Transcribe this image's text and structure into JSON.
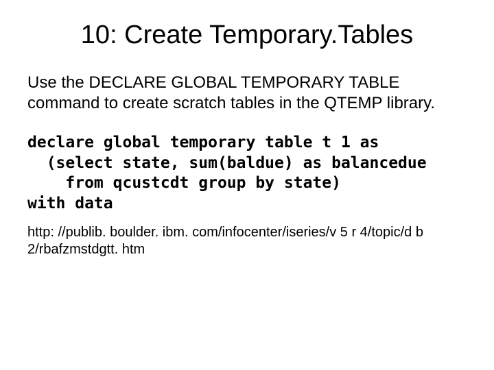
{
  "slide": {
    "title": "10: Create Temporary.Tables",
    "body": "Use the DECLARE GLOBAL TEMPORARY TABLE command to create scratch tables in the QTEMP library.",
    "code": "declare global temporary table t 1 as\n  (select state, sum(baldue) as balancedue\n    from qcustcdt group by state)\nwith data",
    "url": "http: //publib. boulder. ibm. com/infocenter/iseries/v 5 r 4/topic/d b 2/rbafzmstdgtt. htm"
  }
}
